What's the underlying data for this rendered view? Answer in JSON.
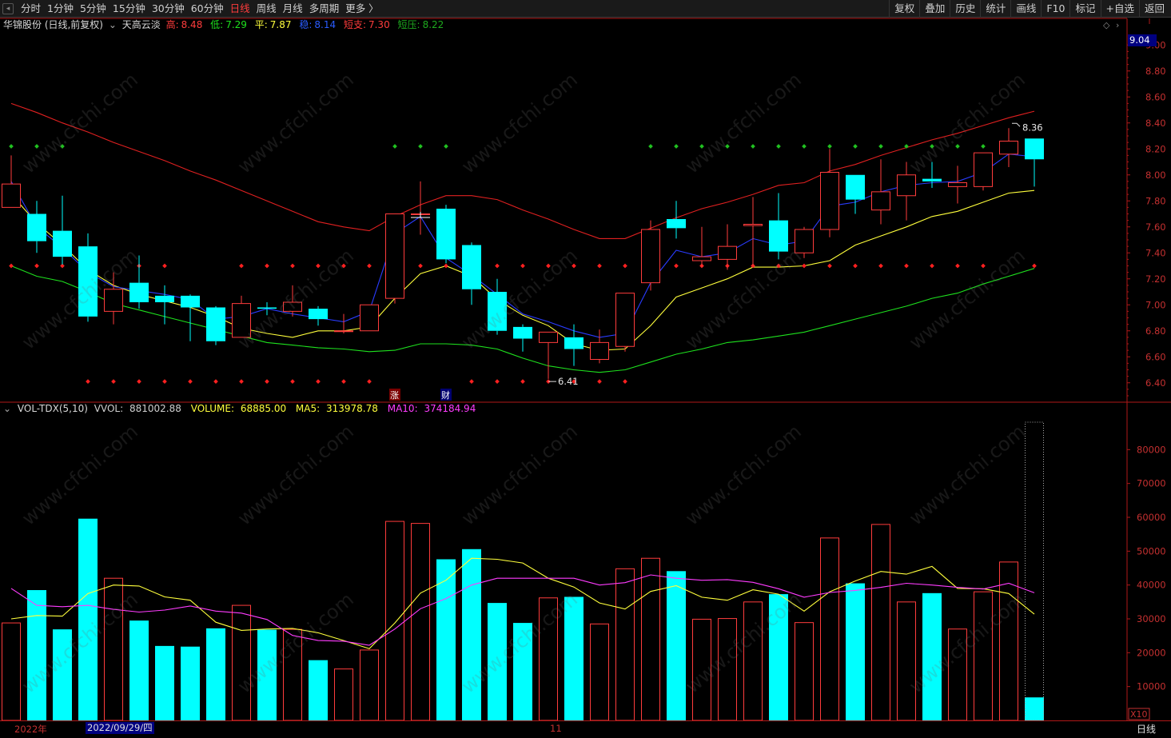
{
  "toolbar": {
    "periods": [
      "分时",
      "1分钟",
      "5分钟",
      "15分钟",
      "30分钟",
      "60分钟",
      "日线",
      "周线",
      "月线",
      "多周期",
      "更多 〉"
    ],
    "active_period": "日线",
    "tools": [
      "复权",
      "叠加",
      "历史",
      "统计",
      "画线",
      "F10",
      "标记",
      "+自选",
      "返回"
    ]
  },
  "stock_title": "华锦股份 (日线,前复权)",
  "indicator": {
    "name": "天高云淡",
    "items": [
      {
        "label": "高:",
        "value": "8.48",
        "color": "#ff3c3c"
      },
      {
        "label": "低:",
        "value": "7.29",
        "color": "#1ee11e"
      },
      {
        "label": "平:",
        "value": "7.87",
        "color": "#ffff3c"
      },
      {
        "label": "稳:",
        "value": "8.14",
        "color": "#2a5cff"
      },
      {
        "label": "短支:",
        "value": "7.30",
        "color": "#ff3c3c"
      },
      {
        "label": "短压:",
        "value": "8.22",
        "color": "#1ea81e"
      }
    ]
  },
  "volume_indicator": {
    "name": "VOL-TDX(5,10)",
    "items": [
      {
        "label": "VVOL:",
        "value": "881002.88",
        "color": "#d0d0d0"
      },
      {
        "label": "VOLUME:",
        "value": "68885.00",
        "color": "#ffff3c"
      },
      {
        "label": "MA5:",
        "value": "313978.78",
        "color": "#ffff3c"
      },
      {
        "label": "MA10:",
        "value": "374184.94",
        "color": "#ff3cff"
      }
    ]
  },
  "price_axis": {
    "current_price": "9.04",
    "ticks": [
      "9.00",
      "8.80",
      "8.60",
      "8.40",
      "8.20",
      "8.00",
      "7.80",
      "7.60",
      "7.40",
      "7.20",
      "7.00",
      "6.80",
      "6.60",
      "6.40"
    ]
  },
  "volume_axis": {
    "ticks": [
      "80000",
      "70000",
      "60000",
      "50000",
      "40000",
      "30000",
      "20000",
      "10000"
    ],
    "unit": "X10"
  },
  "annotations": {
    "high_label": "8.36",
    "low_label": "6.41",
    "marker_zhang": "涨",
    "marker_cai": "财"
  },
  "bottom": {
    "year_label": "2022年",
    "cursor_date": "2022/09/29/四",
    "month_label": "11",
    "period_label": "日线"
  },
  "watermark": "www.cfchi.com",
  "colors": {
    "up": "#ff3c3c",
    "down": "#00ffff",
    "high_line": "#e02020",
    "low_line": "#1ee11e",
    "mid_line": "#ffff3c",
    "stable_line": "#2a3cff",
    "ma10": "#ff3cff",
    "grid": "#b01818"
  },
  "chart_data": {
    "type": "candlestick",
    "candles": [
      [
        7.75,
        7.93,
        8.15,
        7.75
      ],
      [
        7.7,
        7.49,
        7.8,
        7.4
      ],
      [
        7.57,
        7.37,
        7.84,
        7.31
      ],
      [
        7.45,
        6.91,
        7.55,
        6.87
      ],
      [
        6.95,
        7.12,
        7.25,
        6.85
      ],
      [
        7.17,
        7.02,
        7.38,
        6.97
      ],
      [
        7.07,
        7.02,
        7.15,
        6.85
      ],
      [
        7.07,
        6.98,
        7.08,
        6.72
      ],
      [
        6.98,
        6.72,
        6.99,
        6.69
      ],
      [
        6.75,
        7.01,
        7.07,
        6.75
      ],
      [
        6.98,
        6.97,
        7.02,
        6.92
      ],
      [
        6.95,
        7.02,
        7.15,
        6.91
      ],
      [
        6.97,
        6.89,
        6.99,
        6.84
      ],
      [
        6.8,
        6.8,
        6.93,
        6.78
      ],
      [
        6.8,
        7.0,
        7.0,
        6.83
      ],
      [
        7.05,
        7.7,
        7.7,
        7.01
      ],
      [
        7.7,
        7.7,
        7.95,
        7.54
      ],
      [
        7.74,
        7.35,
        7.77,
        7.32
      ],
      [
        7.46,
        7.12,
        7.48,
        7.0
      ],
      [
        7.1,
        6.8,
        7.2,
        6.77
      ],
      [
        6.83,
        6.74,
        6.85,
        6.64
      ],
      [
        6.71,
        6.79,
        6.77,
        6.43
      ],
      [
        6.75,
        6.66,
        6.85,
        6.53
      ],
      [
        6.58,
        6.71,
        6.81,
        6.55
      ],
      [
        6.68,
        7.09,
        7.08,
        6.64
      ],
      [
        7.17,
        7.58,
        7.65,
        7.11
      ],
      [
        7.66,
        7.59,
        7.8,
        7.51
      ],
      [
        7.34,
        7.37,
        7.6,
        7.29
      ],
      [
        7.35,
        7.45,
        7.62,
        7.27
      ],
      [
        7.61,
        7.62,
        7.83,
        7.29
      ],
      [
        7.65,
        7.41,
        7.86,
        7.35
      ],
      [
        7.4,
        7.58,
        7.6,
        7.36
      ],
      [
        7.58,
        8.02,
        8.2,
        7.52
      ],
      [
        8.0,
        7.81,
        8.0,
        7.7
      ],
      [
        7.73,
        7.87,
        8.12,
        7.62
      ],
      [
        7.84,
        8.0,
        8.1,
        7.65
      ],
      [
        7.97,
        7.95,
        8.1,
        7.9
      ],
      [
        7.91,
        7.94,
        8.07,
        7.78
      ],
      [
        7.91,
        8.17,
        8.17,
        7.88
      ],
      [
        8.16,
        8.26,
        8.36,
        8.06
      ],
      [
        8.28,
        8.12,
        8.28,
        7.91
      ]
    ],
    "volumes": [
      28800,
      38500,
      26900,
      59600,
      42000,
      29500,
      22000,
      21800,
      27200,
      34000,
      26800,
      26900,
      17800,
      15200,
      20800,
      58800,
      58200,
      47600,
      50600,
      34700,
      28800,
      36200,
      36500,
      28500,
      44800,
      47900,
      44100,
      29900,
      30100,
      35000,
      37300,
      28900,
      53900,
      40500,
      57900,
      35000,
      37600,
      27000,
      38000,
      46800,
      6800
    ],
    "ma_high": [
      8.55,
      8.48,
      8.4,
      8.33,
      8.25,
      8.18,
      8.11,
      8.03,
      7.96,
      7.88,
      7.8,
      7.72,
      7.64,
      7.6,
      7.57,
      7.68,
      7.77,
      7.84,
      7.84,
      7.81,
      7.73,
      7.66,
      7.58,
      7.51,
      7.51,
      7.59,
      7.67,
      7.74,
      7.79,
      7.85,
      7.92,
      7.94,
      8.03,
      8.08,
      8.15,
      8.21,
      8.27,
      8.32,
      8.38,
      8.44,
      8.49
    ],
    "ma_low": [
      7.3,
      7.22,
      7.18,
      7.1,
      7.01,
      6.96,
      6.91,
      6.86,
      6.81,
      6.76,
      6.71,
      6.69,
      6.67,
      6.66,
      6.64,
      6.65,
      6.7,
      6.7,
      6.69,
      6.66,
      6.59,
      6.53,
      6.5,
      6.48,
      6.5,
      6.56,
      6.62,
      6.66,
      6.71,
      6.73,
      6.76,
      6.79,
      6.84,
      6.89,
      6.94,
      6.99,
      7.05,
      7.09,
      7.16,
      7.22,
      7.28
    ],
    "ma_mid": [
      7.85,
      7.63,
      7.46,
      7.27,
      7.15,
      7.08,
      7.03,
      6.98,
      6.91,
      6.82,
      6.78,
      6.75,
      6.8,
      6.8,
      6.83,
      7.05,
      7.24,
      7.3,
      7.22,
      7.04,
      6.92,
      6.84,
      6.7,
      6.65,
      6.66,
      6.84,
      7.06,
      7.13,
      7.2,
      7.29,
      7.29,
      7.3,
      7.34,
      7.46,
      7.53,
      7.6,
      7.68,
      7.72,
      7.79,
      7.86,
      7.88
    ],
    "ma_stable": [
      7.95,
      7.6,
      7.44,
      7.25,
      7.14,
      7.11,
      7.08,
      7.04,
      6.89,
      6.91,
      6.97,
      6.93,
      6.9,
      6.87,
      6.95,
      7.55,
      7.68,
      7.36,
      7.23,
      7.08,
      6.93,
      6.87,
      6.8,
      6.75,
      6.78,
      7.17,
      7.42,
      7.37,
      7.4,
      7.51,
      7.46,
      7.49,
      7.76,
      7.79,
      7.87,
      7.92,
      7.94,
      7.95,
      8.02,
      8.16,
      8.14
    ],
    "vol_ma5": [
      30000,
      31000,
      30800,
      37500,
      40000,
      39700,
      36500,
      35500,
      29000,
      26600,
      27000,
      27200,
      25900,
      23600,
      21200,
      28800,
      37600,
      41400,
      47900,
      47600,
      46500,
      42000,
      39400,
      34700,
      32900,
      38100,
      39800,
      36400,
      35500,
      38600,
      37300,
      32300,
      38000,
      41200,
      44000,
      43200,
      45500,
      39000,
      38900,
      37500,
      31400
    ],
    "vol_ma10": [
      39000,
      34000,
      33600,
      34000,
      32800,
      32000,
      32600,
      33800,
      32300,
      31700,
      29800,
      25100,
      23600,
      23400,
      22200,
      27000,
      33000,
      36000,
      40000,
      42000,
      42000,
      42000,
      42000,
      40000,
      40700,
      43000,
      42000,
      41400,
      41600,
      40800,
      38900,
      36400,
      37800,
      38400,
      39300,
      40500,
      40000,
      39300,
      38800,
      40500,
      37700
    ],
    "ylim_price": [
      6.3,
      9.1
    ],
    "ylim_volume": [
      0,
      90000
    ]
  }
}
